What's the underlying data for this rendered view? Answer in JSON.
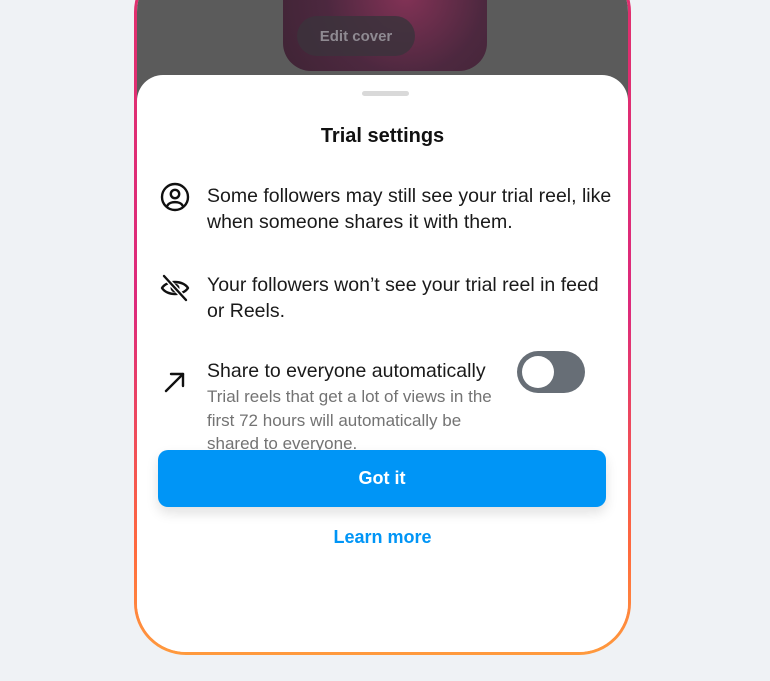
{
  "cover": {
    "edit_label": "Edit cover"
  },
  "sheet": {
    "title": "Trial settings",
    "items": [
      {
        "icon": "person-circle-icon",
        "text": "Some followers may still see your trial reel, like when someone shares it with them."
      },
      {
        "icon": "eye-off-icon",
        "text": "Your followers won’t see your trial reel in feed or Reels."
      },
      {
        "icon": "arrow-up-right-icon",
        "text": "Share to everyone automatically",
        "subtext": "Trial reels that get a lot of views in the first 72 hours will automatically be shared to everyone.",
        "toggle_on": false
      }
    ],
    "primary_button": "Got it",
    "secondary_link": "Learn more"
  },
  "colors": {
    "accent": "#0095f6",
    "toggle_off": "#676e76",
    "frame_top": "#e1306c",
    "frame_bottom": "#ff9a3d"
  }
}
